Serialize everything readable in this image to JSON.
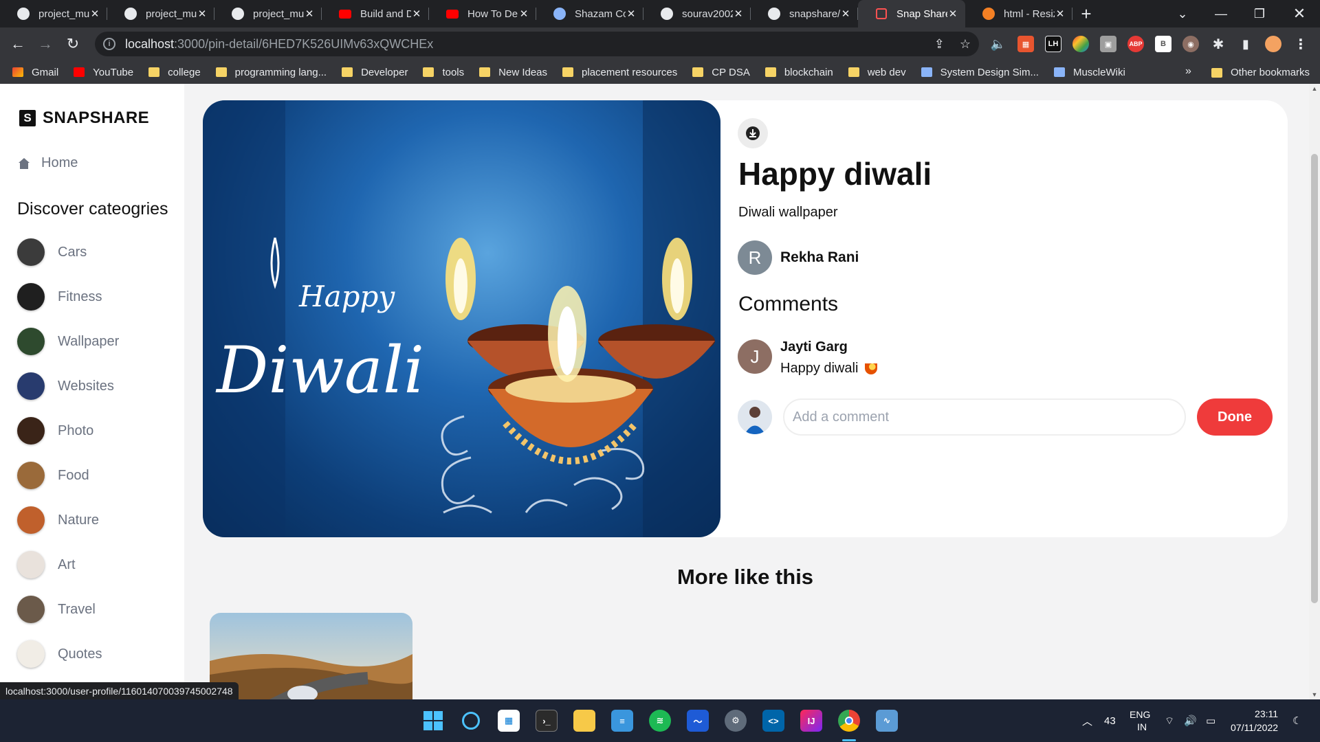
{
  "browser": {
    "tabs": [
      {
        "title": "project_mu",
        "icon": "github-icon"
      },
      {
        "title": "project_mu",
        "icon": "github-icon"
      },
      {
        "title": "project_mu",
        "icon": "github-icon"
      },
      {
        "title": "Build and D",
        "icon": "youtube-icon"
      },
      {
        "title": "How To Dep",
        "icon": "youtube-icon"
      },
      {
        "title": "Shazam Cor",
        "icon": "shazam-icon"
      },
      {
        "title": "sourav2002",
        "icon": "github-icon"
      },
      {
        "title": "snapshare/f",
        "icon": "github-icon"
      },
      {
        "title": "Snap Share",
        "icon": "snapshare-icon",
        "active": true
      },
      {
        "title": "html - Resiz",
        "icon": "stackoverflow-icon"
      }
    ],
    "url_host": "localhost",
    "url_path": ":3000/pin-detail/6HED7K526UIMv63xQWCHEx",
    "bookmarks": [
      {
        "label": "Gmail",
        "icon": "gmail-icon"
      },
      {
        "label": "YouTube",
        "icon": "youtube-icon"
      },
      {
        "label": "college",
        "icon": "folder-icon"
      },
      {
        "label": "programming lang...",
        "icon": "folder-icon"
      },
      {
        "label": "Developer",
        "icon": "folder-icon"
      },
      {
        "label": "tools",
        "icon": "folder-icon"
      },
      {
        "label": "New Ideas",
        "icon": "folder-icon"
      },
      {
        "label": "placement resources",
        "icon": "folder-icon"
      },
      {
        "label": "CP DSA",
        "icon": "folder-icon"
      },
      {
        "label": "blockchain",
        "icon": "folder-icon"
      },
      {
        "label": "web dev",
        "icon": "folder-icon"
      },
      {
        "label": "System Design Sim...",
        "icon": "link-icon"
      },
      {
        "label": "MuscleWiki",
        "icon": "link-icon"
      }
    ],
    "bookmarks_overflow": "»",
    "other_bookmarks": "Other bookmarks",
    "status_url": "localhost:3000/user-profile/116014070039745002748",
    "extensions": [
      "LH",
      "ABP",
      "B"
    ]
  },
  "app": {
    "brand": "SNAPSHARE",
    "brand_mark": "S",
    "home_label": "Home",
    "discover_heading": "Discover cateogries",
    "categories": [
      "Cars",
      "Fitness",
      "Wallpaper",
      "Websites",
      "Photo",
      "Food",
      "Nature",
      "Art",
      "Travel",
      "Quotes"
    ]
  },
  "pin": {
    "title": "Happy diwali",
    "description": "Diwali wallpaper",
    "image_text_top": "Happy",
    "image_text_bottom": "Diwali",
    "author": {
      "initial": "R",
      "name": "Rekha Rani",
      "avatar_color": "#7d8a95"
    },
    "comments_heading": "Comments",
    "comments": [
      {
        "initial": "J",
        "name": "Jayti Garg",
        "text": "Happy diwali",
        "emoji": "diya-icon",
        "avatar_color": "#8d6e63"
      }
    ],
    "add_comment_placeholder": "Add a comment",
    "done_label": "Done",
    "accent": "#ef3b3b"
  },
  "more": {
    "heading": "More like this"
  },
  "taskbar": {
    "temperature": "43",
    "lang_top": "ENG",
    "lang_bottom": "IN",
    "time": "23:11",
    "date": "07/11/2022"
  }
}
